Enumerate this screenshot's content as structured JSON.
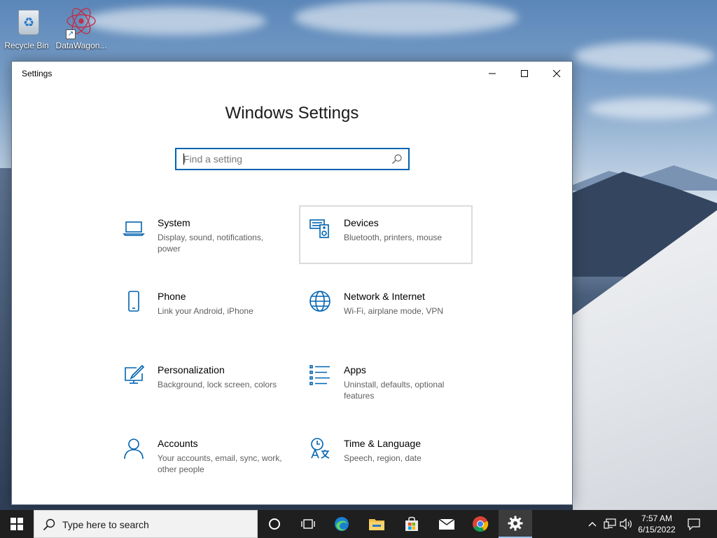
{
  "desktop": {
    "icons": [
      {
        "label": "Recycle Bin"
      },
      {
        "label": "DataWagon..."
      }
    ]
  },
  "window": {
    "title": "Settings",
    "page_title": "Windows Settings",
    "search": {
      "placeholder": "Find a setting",
      "value": ""
    }
  },
  "tiles": [
    {
      "title": "System",
      "description": "Display, sound, notifications, power",
      "icon": "laptop-icon"
    },
    {
      "title": "Devices",
      "description": "Bluetooth, printers, mouse",
      "icon": "devices-icon"
    },
    {
      "title": "Phone",
      "description": "Link your Android, iPhone",
      "icon": "phone-icon"
    },
    {
      "title": "Network & Internet",
      "description": "Wi-Fi, airplane mode, VPN",
      "icon": "globe-icon"
    },
    {
      "title": "Personalization",
      "description": "Background, lock screen, colors",
      "icon": "personalization-icon"
    },
    {
      "title": "Apps",
      "description": "Uninstall, defaults, optional features",
      "icon": "apps-list-icon"
    },
    {
      "title": "Accounts",
      "description": "Your accounts, email, sync, work, other people",
      "icon": "person-icon"
    },
    {
      "title": "Time & Language",
      "description": "Speech, region, date",
      "icon": "time-language-icon"
    }
  ],
  "taskbar": {
    "search_placeholder": "Type here to search",
    "apps": [
      "cortana-icon",
      "task-view-icon",
      "edge-icon",
      "file-explorer-icon",
      "store-icon",
      "mail-icon",
      "chrome-icon",
      "settings-gear-icon"
    ],
    "active_app": "settings-gear-icon",
    "clock": {
      "time": "7:57 AM",
      "date": "6/15/2022"
    }
  },
  "colors": {
    "accent": "#0063b1",
    "taskbar": "#1f1f1f",
    "window_bg": "#ffffff"
  }
}
